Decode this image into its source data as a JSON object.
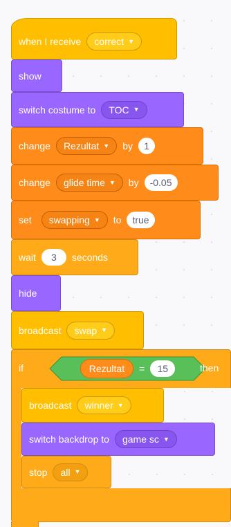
{
  "colors": {
    "events": "#ffbf00",
    "looks": "#9966ff",
    "variables": "#ff8c1a",
    "control": "#ffab19",
    "operators": "#59c059"
  },
  "script": {
    "when_receive": {
      "label": "when I receive",
      "message": "correct"
    },
    "show": {
      "label": "show"
    },
    "switch_costume": {
      "label": "switch costume to",
      "costume": "TOC"
    },
    "change_rezultat": {
      "label": "change",
      "variable": "Rezultat",
      "by_label": "by",
      "value": "1"
    },
    "change_glide": {
      "label": "change",
      "variable": "glide time",
      "by_label": "by",
      "value": "-0.05"
    },
    "set_swapping": {
      "label": "set",
      "variable": "swapping",
      "to_label": "to",
      "value": "true"
    },
    "wait": {
      "label": "wait",
      "value": "3",
      "unit": "seconds"
    },
    "hide": {
      "label": "hide"
    },
    "broadcast_swap": {
      "label": "broadcast",
      "message": "swap"
    },
    "if_block": {
      "if_label": "if",
      "then_label": "then",
      "condition": {
        "left": "Rezultat",
        "operator": "=",
        "right": "15"
      },
      "body": {
        "broadcast_winner": {
          "label": "broadcast",
          "message": "winner"
        },
        "switch_backdrop": {
          "label": "switch backdrop to",
          "backdrop": "game sc"
        },
        "stop": {
          "label": "stop",
          "option": "all"
        }
      }
    }
  }
}
